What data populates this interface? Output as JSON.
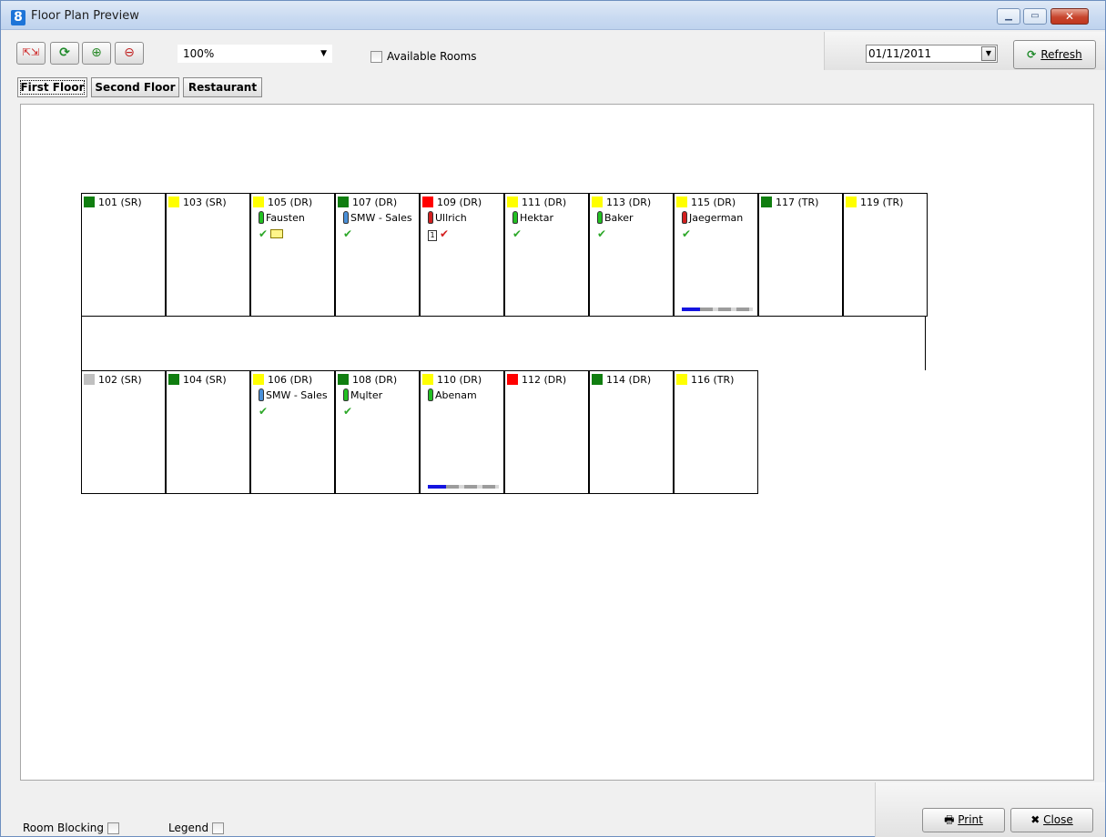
{
  "window": {
    "title": "Floor Plan Preview",
    "app_icon": "8",
    "minimize_icon": "minimize-icon",
    "maximize_icon": "maximize-icon",
    "close_icon": "close-icon"
  },
  "toolbar": {
    "zoom_value": "100%",
    "available_rooms_label": "Available Rooms",
    "available_rooms_checked": false,
    "date_value": "01/11/2011",
    "refresh_label": "Refresh"
  },
  "tabs": [
    {
      "label": "First Floor",
      "active": true
    },
    {
      "label": "Second Floor",
      "active": false
    },
    {
      "label": "Restaurant",
      "active": false
    }
  ],
  "colors": {
    "green": "#107e10",
    "yellow": "#ffff00",
    "red": "#ff0000",
    "grey": "#c0c0c0",
    "guest_green": "#22c022",
    "guest_blue": "#4a90d9",
    "guest_red": "#d21f1f"
  },
  "rooms_top": [
    {
      "label": "101 (SR)",
      "status": "green"
    },
    {
      "label": "103 (SR)",
      "status": "yellow"
    },
    {
      "label": "105 (DR)",
      "status": "yellow",
      "guest": "Fausten",
      "guest_color": "green",
      "checked": "green",
      "mail": true
    },
    {
      "label": "107 (DR)",
      "status": "green",
      "guest": "SMW - Sales",
      "guest_color": "blue",
      "checked": "green"
    },
    {
      "label": "109 (DR)",
      "status": "red",
      "guest": "Ullrich",
      "guest_color": "red",
      "checked": "red",
      "badge": "1"
    },
    {
      "label": "111 (DR)",
      "status": "yellow",
      "guest": "Hektar",
      "guest_color": "green",
      "checked": "green"
    },
    {
      "label": "113 (DR)",
      "status": "yellow",
      "guest": "Baker",
      "guest_color": "green",
      "checked": "green"
    },
    {
      "label": "115 (DR)",
      "status": "yellow",
      "guest": "Jaegerman",
      "guest_color": "red",
      "checked": "green",
      "progress": 0.25
    },
    {
      "label": "117 (TR)",
      "status": "green"
    },
    {
      "label": "119 (TR)",
      "status": "yellow"
    }
  ],
  "rooms_bottom": [
    {
      "label": "102 (SR)",
      "status": "grey"
    },
    {
      "label": "104 (SR)",
      "status": "green"
    },
    {
      "label": "106 (DR)",
      "status": "yellow",
      "guest": "SMW - Sales",
      "guest_color": "blue",
      "checked": "green"
    },
    {
      "label": "108 (DR)",
      "status": "green",
      "guest": "Mɥlter",
      "guest_color": "green",
      "checked": "green"
    },
    {
      "label": "110 (DR)",
      "status": "yellow",
      "guest": "Abenam",
      "guest_color": "green",
      "progress": 0.25
    },
    {
      "label": "112 (DR)",
      "status": "red"
    },
    {
      "label": "114 (DR)",
      "status": "green"
    },
    {
      "label": "116 (TR)",
      "status": "yellow"
    }
  ],
  "statusbar": {
    "room_blocking_label": "Room Blocking",
    "legend_label": "Legend",
    "print_label": "Print",
    "close_label": "Close"
  }
}
